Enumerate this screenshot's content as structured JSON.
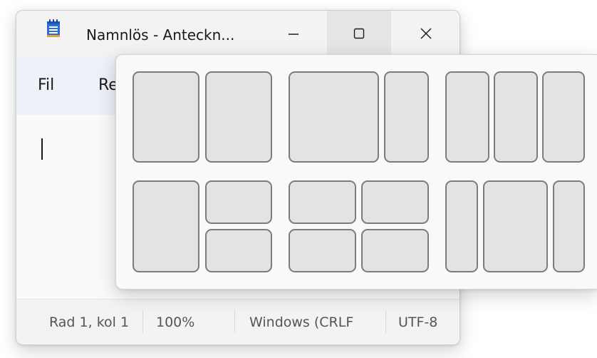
{
  "window": {
    "title": "Namnlös - Anteckn...",
    "icon": "notepad-icon",
    "controls": [
      "minimize-icon",
      "maximize-icon",
      "close-icon"
    ]
  },
  "menu": {
    "items": [
      {
        "label": "Fil"
      },
      {
        "label": "Re"
      }
    ]
  },
  "status": {
    "position": "Rad 1, kol 1",
    "zoom": "100%",
    "line_ending": "Windows (CRLF",
    "encoding": "UTF-8"
  },
  "snap_layouts": {
    "rows": [
      {
        "layouts": [
          "halves",
          "two-thirds-one-third",
          "thirds"
        ]
      },
      {
        "layouts": [
          "left-half-right-quarters",
          "quarters",
          "wide-center"
        ]
      }
    ]
  },
  "colors": {
    "accent": "#0067c0",
    "menubar": "#eff1f8",
    "zone_fill": "#e3e3e3",
    "zone_border": "#7c7c7c"
  }
}
